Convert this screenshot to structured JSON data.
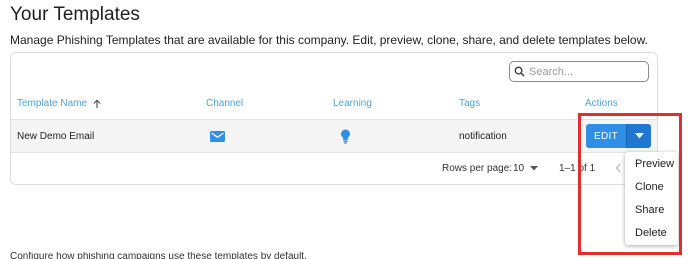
{
  "header": {
    "title": "Your Templates",
    "description": "Manage Phishing Templates that are available for this company. Edit, preview, clone, share, and delete templates below."
  },
  "search": {
    "placeholder": "Search..."
  },
  "table": {
    "columns": {
      "name": "Template Name",
      "channel": "Channel",
      "learning": "Learning",
      "tags": "Tags",
      "actions": "Actions"
    },
    "sort_icon": "arrow-up-icon",
    "rows": [
      {
        "name": "New Demo Email",
        "channel_icon": "email-icon",
        "learning_icon": "lightbulb-icon",
        "tags": "notification",
        "action_label": "EDIT"
      }
    ]
  },
  "pagination": {
    "rows_per_page_label": "Rows per page:",
    "rows_per_page_value": "10",
    "range": "1–1 of 1"
  },
  "action_menu": {
    "items": [
      "Preview",
      "Clone",
      "Share",
      "Delete"
    ]
  },
  "bottom_text": "Configure how phishing campaigns use these templates by default."
}
